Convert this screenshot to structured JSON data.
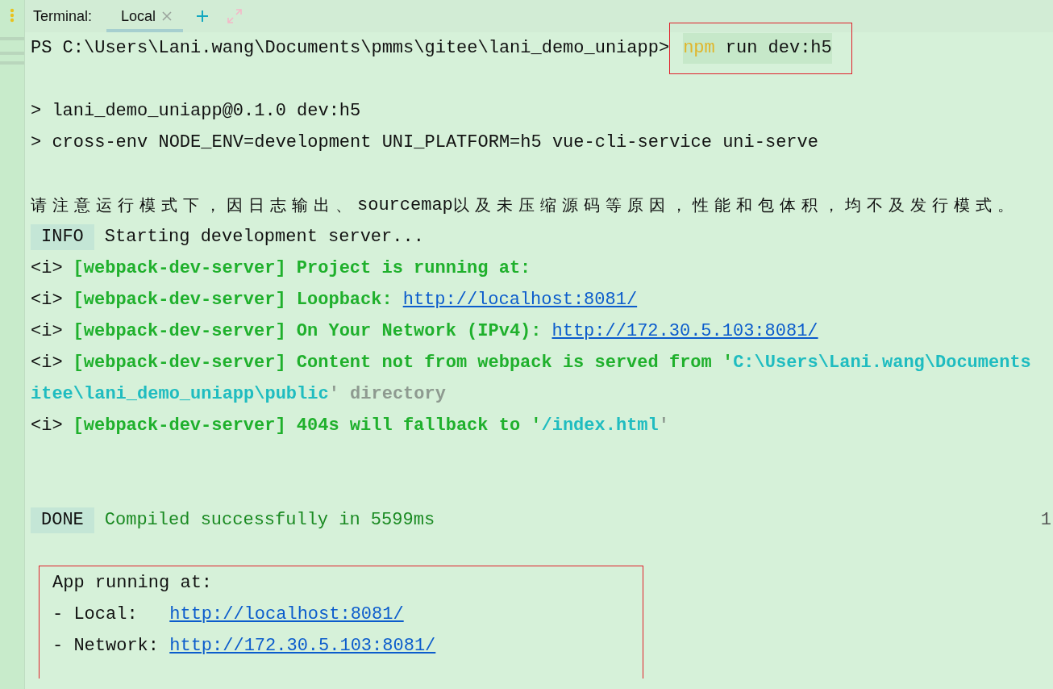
{
  "tabs_bar": {
    "label": "Terminal:",
    "tabs": [
      {
        "label": "Local",
        "selected": true
      }
    ]
  },
  "lines": [
    {
      "kind": "prompt",
      "segments": [
        {
          "kind": "plain",
          "text": "PS C:\\Users\\Lani.wang\\Documents\\pmms\\gitee\\lani_demo_uniapp>"
        }
      ],
      "command": [
        {
          "kind": "keyword",
          "text": "npm"
        },
        {
          "kind": "plain",
          "text": "run dev:h5"
        }
      ]
    },
    {
      "kind": "blank"
    },
    {
      "kind": "text",
      "segments": [
        {
          "kind": "plain",
          "text": "> lani_demo_uniapp@0.1.0 dev:h5"
        }
      ]
    },
    {
      "kind": "text",
      "segments": [
        {
          "kind": "plain",
          "text": "> cross-env NODE_ENV=development UNI_PLATFORM=h5 vue-cli-service uni-serve"
        }
      ]
    },
    {
      "kind": "blank"
    },
    {
      "kind": "text",
      "segments": [
        {
          "kind": "cjk",
          "text": "请注意运行模式下，因日志输出、"
        },
        {
          "kind": "plain",
          "text": "sourcemap"
        },
        {
          "kind": "cjk",
          "text": "以及未压缩源码等原因，性能和包体积，均不及发行模式。"
        }
      ]
    },
    {
      "kind": "text",
      "segments": [
        {
          "kind": "badge",
          "text": "INFO"
        },
        {
          "kind": "plain",
          "text": "Starting development server..."
        }
      ]
    },
    {
      "kind": "text",
      "segments": [
        {
          "kind": "plain",
          "text": "<i>"
        },
        {
          "kind": "green",
          "text": "[webpack-dev-server] Project is running at:"
        }
      ]
    },
    {
      "kind": "text",
      "segments": [
        {
          "kind": "plain",
          "text": "<i>"
        },
        {
          "kind": "green",
          "text": "[webpack-dev-server] Loopback:"
        },
        {
          "kind": "link",
          "text": "http://localhost:8081/"
        }
      ]
    },
    {
      "kind": "text",
      "segments": [
        {
          "kind": "plain",
          "text": "<i>"
        },
        {
          "kind": "green",
          "text": "[webpack-dev-server] On Your Network (IPv4):"
        },
        {
          "kind": "link",
          "text": "http://172.30.5.103:8081/"
        }
      ]
    },
    {
      "kind": "text",
      "segments": [
        {
          "kind": "plain",
          "text": "<i>"
        },
        {
          "kind": "green",
          "text": "[webpack-dev-server] Content not from webpack is served from '"
        },
        {
          "kind": "cyan",
          "text": "C:\\Users\\Lani.wang\\Documents"
        }
      ]
    },
    {
      "kind": "text",
      "segments": [
        {
          "kind": "cyan",
          "text": "itee\\lani_demo_uniapp\\public"
        },
        {
          "kind": "grey",
          "text": "' directory"
        }
      ]
    },
    {
      "kind": "text",
      "segments": [
        {
          "kind": "plain",
          "text": "<i>"
        },
        {
          "kind": "green",
          "text": "[webpack-dev-server] 404s will fallback to '"
        },
        {
          "kind": "cyan",
          "text": "/index.html"
        },
        {
          "kind": "grey",
          "text": "'"
        }
      ]
    },
    {
      "kind": "blank"
    },
    {
      "kind": "blank"
    },
    {
      "kind": "text",
      "segments": [
        {
          "kind": "badge",
          "text": "DONE"
        },
        {
          "kind": "success",
          "text": "Compiled successfully in 5599ms"
        }
      ],
      "right_text": "1"
    },
    {
      "kind": "blank"
    }
  ],
  "annotation_box": {
    "lines": [
      {
        "segments": [
          {
            "kind": "plain",
            "text": "App running at:"
          }
        ]
      },
      {
        "segments": [
          {
            "kind": "plain",
            "text": "- Local:   "
          },
          {
            "kind": "link",
            "text": "http://localhost:8081/"
          }
        ]
      },
      {
        "segments": [
          {
            "kind": "plain",
            "text": "- Network: "
          },
          {
            "kind": "link",
            "text": "http://172.30.5.103:8081/"
          }
        ]
      }
    ]
  }
}
